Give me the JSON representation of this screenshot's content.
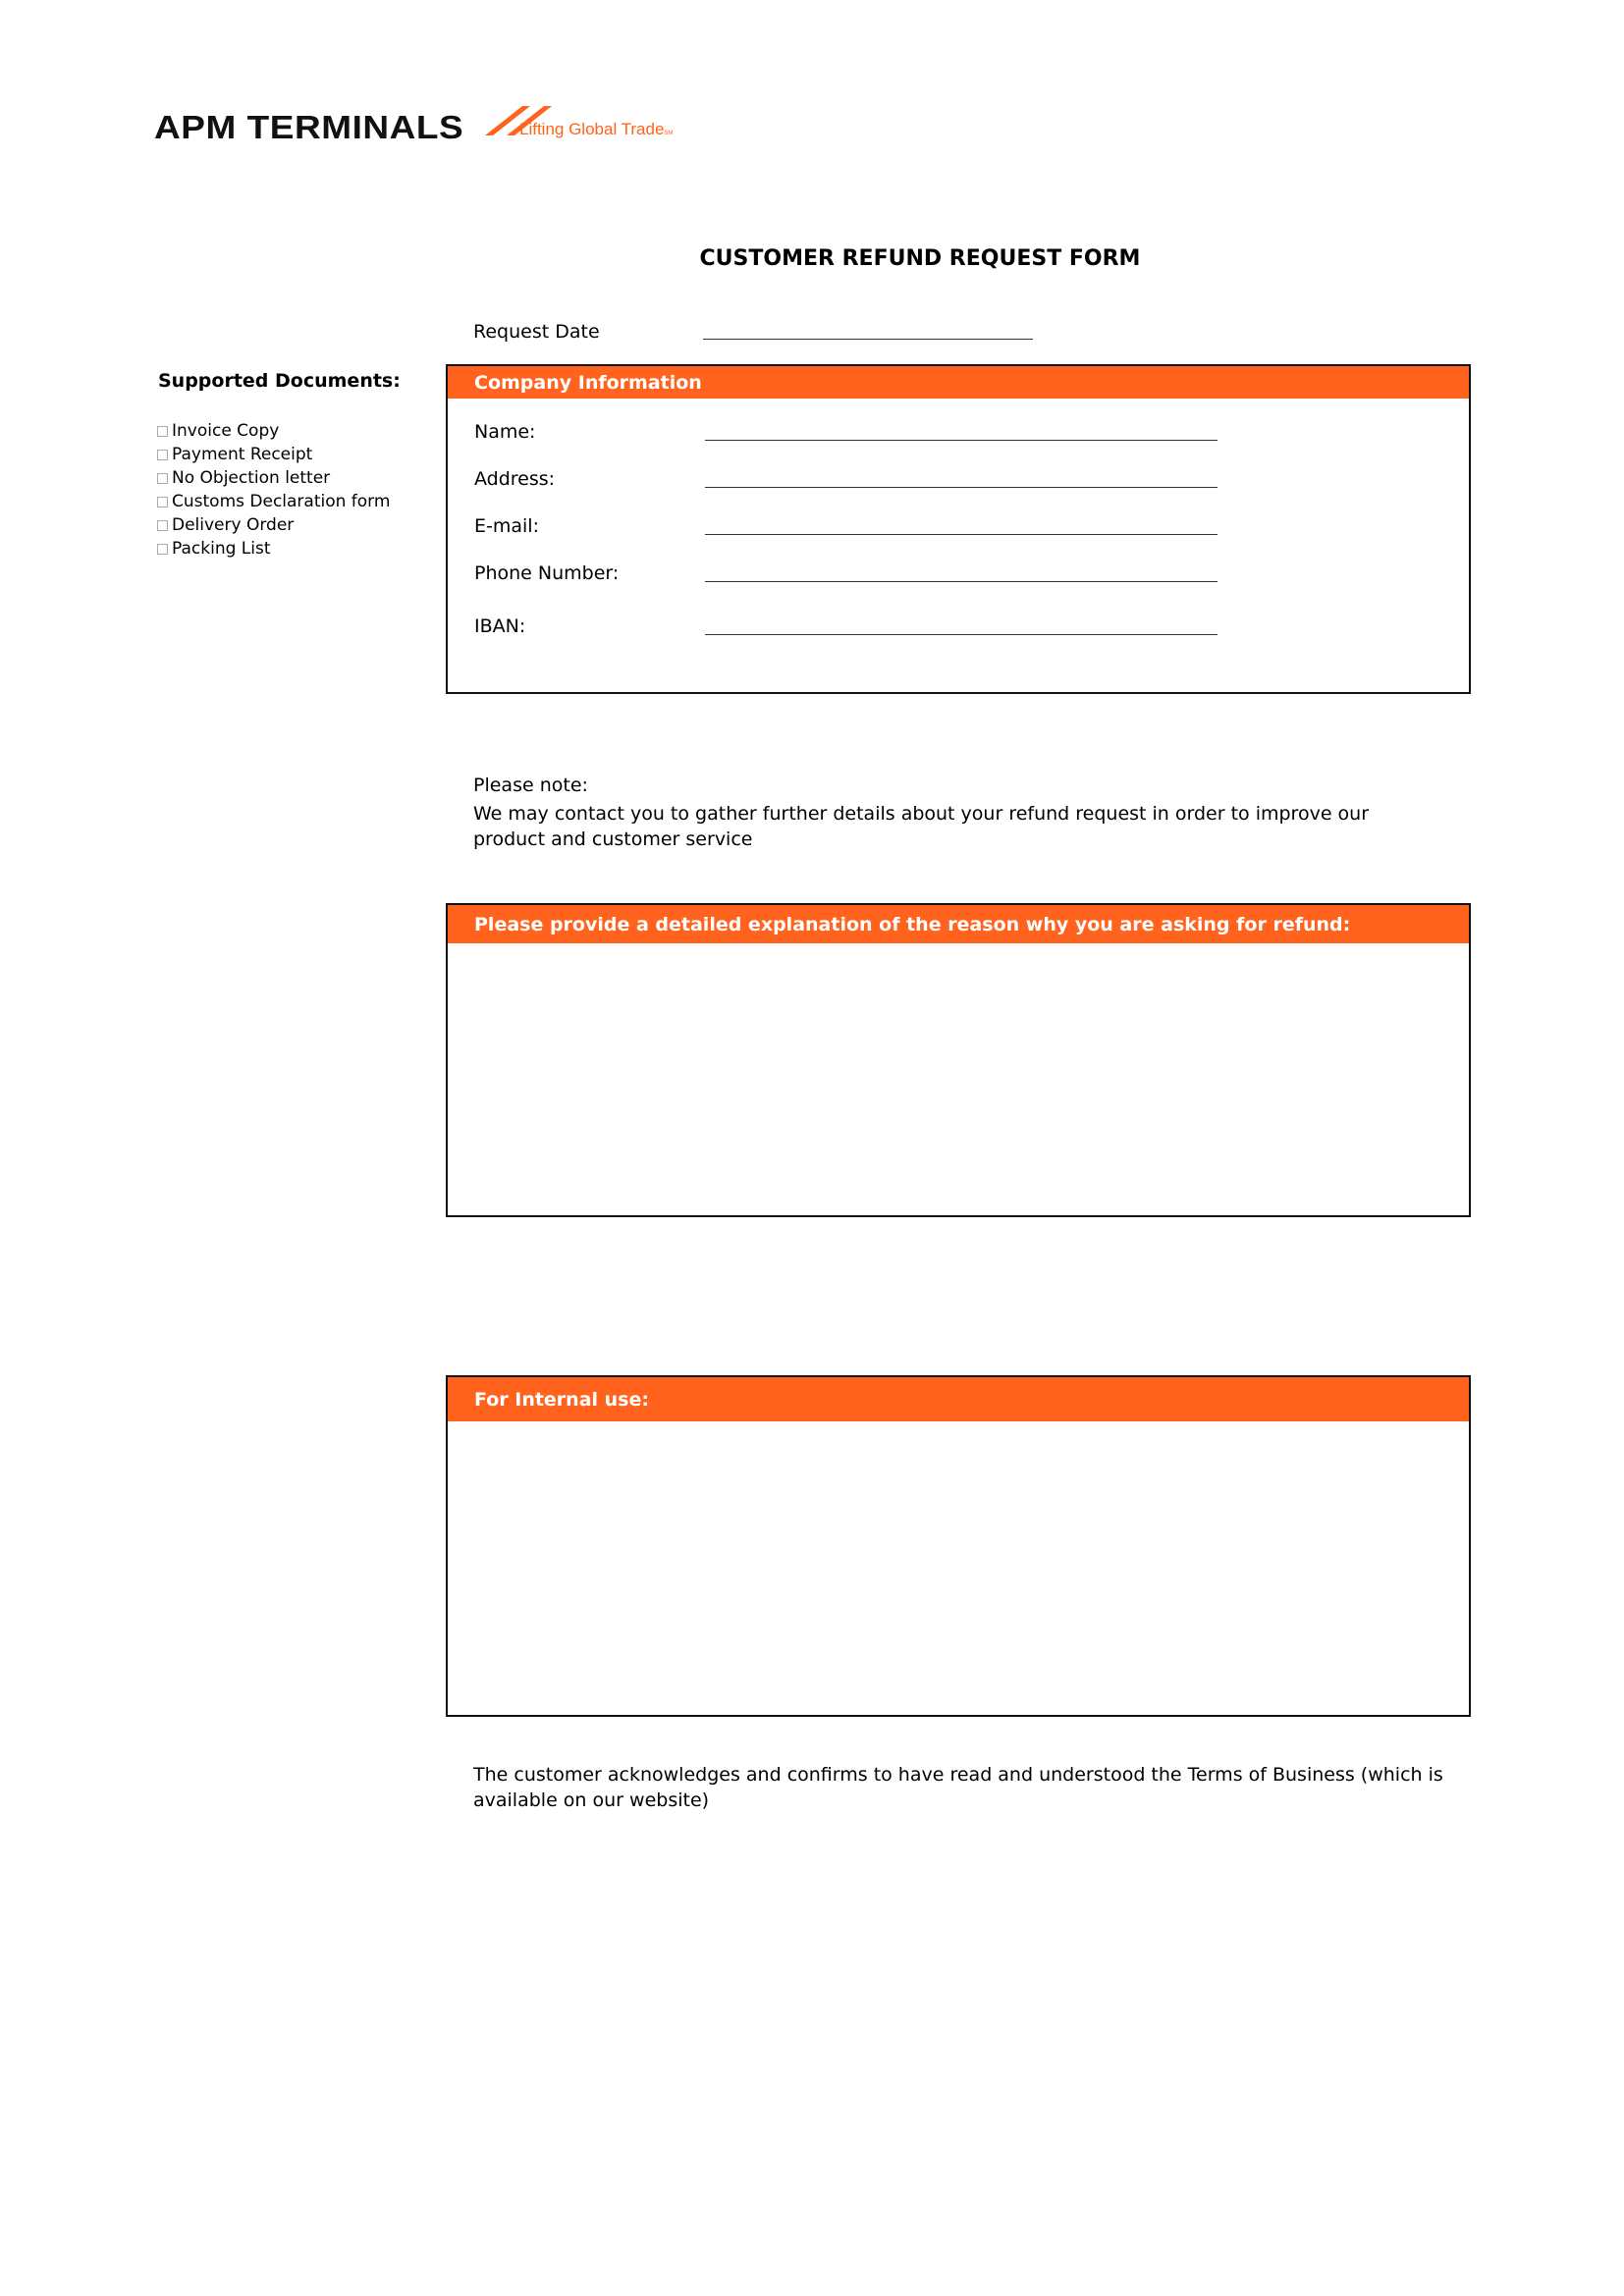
{
  "brand": {
    "name": "APM TERMINALS",
    "tagline": "Lifting Global Trade",
    "tagline_mark": "SM",
    "accent_color": "#ff631e"
  },
  "form": {
    "title": "CUSTOMER REFUND REQUEST FORM",
    "request_date_label": "Request Date",
    "request_date_value": ""
  },
  "supported_documents": {
    "title": "Supported Documents:",
    "items": [
      {
        "label": "Invoice Copy",
        "checked": false
      },
      {
        "label": "Payment Receipt",
        "checked": false
      },
      {
        "label": "No Objection letter",
        "checked": false
      },
      {
        "label": "Customs Declaration form",
        "checked": false
      },
      {
        "label": "Delivery Order",
        "checked": false
      },
      {
        "label": "Packing List",
        "checked": false
      }
    ]
  },
  "company_info": {
    "header": "Company Information",
    "fields": [
      {
        "label": "Name:",
        "value": ""
      },
      {
        "label": "Address:",
        "value": ""
      },
      {
        "label": "E-mail:",
        "value": ""
      },
      {
        "label": "Phone Number:",
        "value": ""
      },
      {
        "label": "IBAN:",
        "value": ""
      }
    ]
  },
  "note": {
    "title": "Please note:",
    "text": "We may contact you to gather further details about your refund request in order to improve our product and customer service"
  },
  "explanation": {
    "header": "Please provide a detailed explanation of the reason why you are asking for refund:",
    "value": ""
  },
  "internal": {
    "header": "For Internal use:",
    "value": ""
  },
  "acknowledgement": {
    "text": "The customer acknowledges and confirms to have read and understood the Terms of Business (which is available on our website)"
  }
}
